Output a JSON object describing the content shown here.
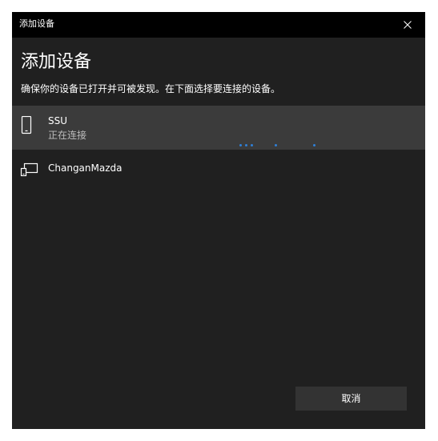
{
  "window": {
    "title": "添加设备"
  },
  "page": {
    "heading": "添加设备",
    "instruction": "确保你的设备已打开并可被发现。在下面选择要连接的设备。"
  },
  "devices": [
    {
      "name": "SSU",
      "status": "正在连接",
      "icon": "phone-icon",
      "selected": true
    },
    {
      "name": "ChanganMazda",
      "status": "",
      "icon": "display-device-icon",
      "selected": false
    }
  ],
  "footer": {
    "cancel_label": "取消"
  },
  "colors": {
    "dialog_bg": "#202020",
    "titlebar_bg": "#000000",
    "selected_row_bg": "#3b3b3b",
    "accent": "#2f80d8",
    "button_bg": "#333333"
  }
}
